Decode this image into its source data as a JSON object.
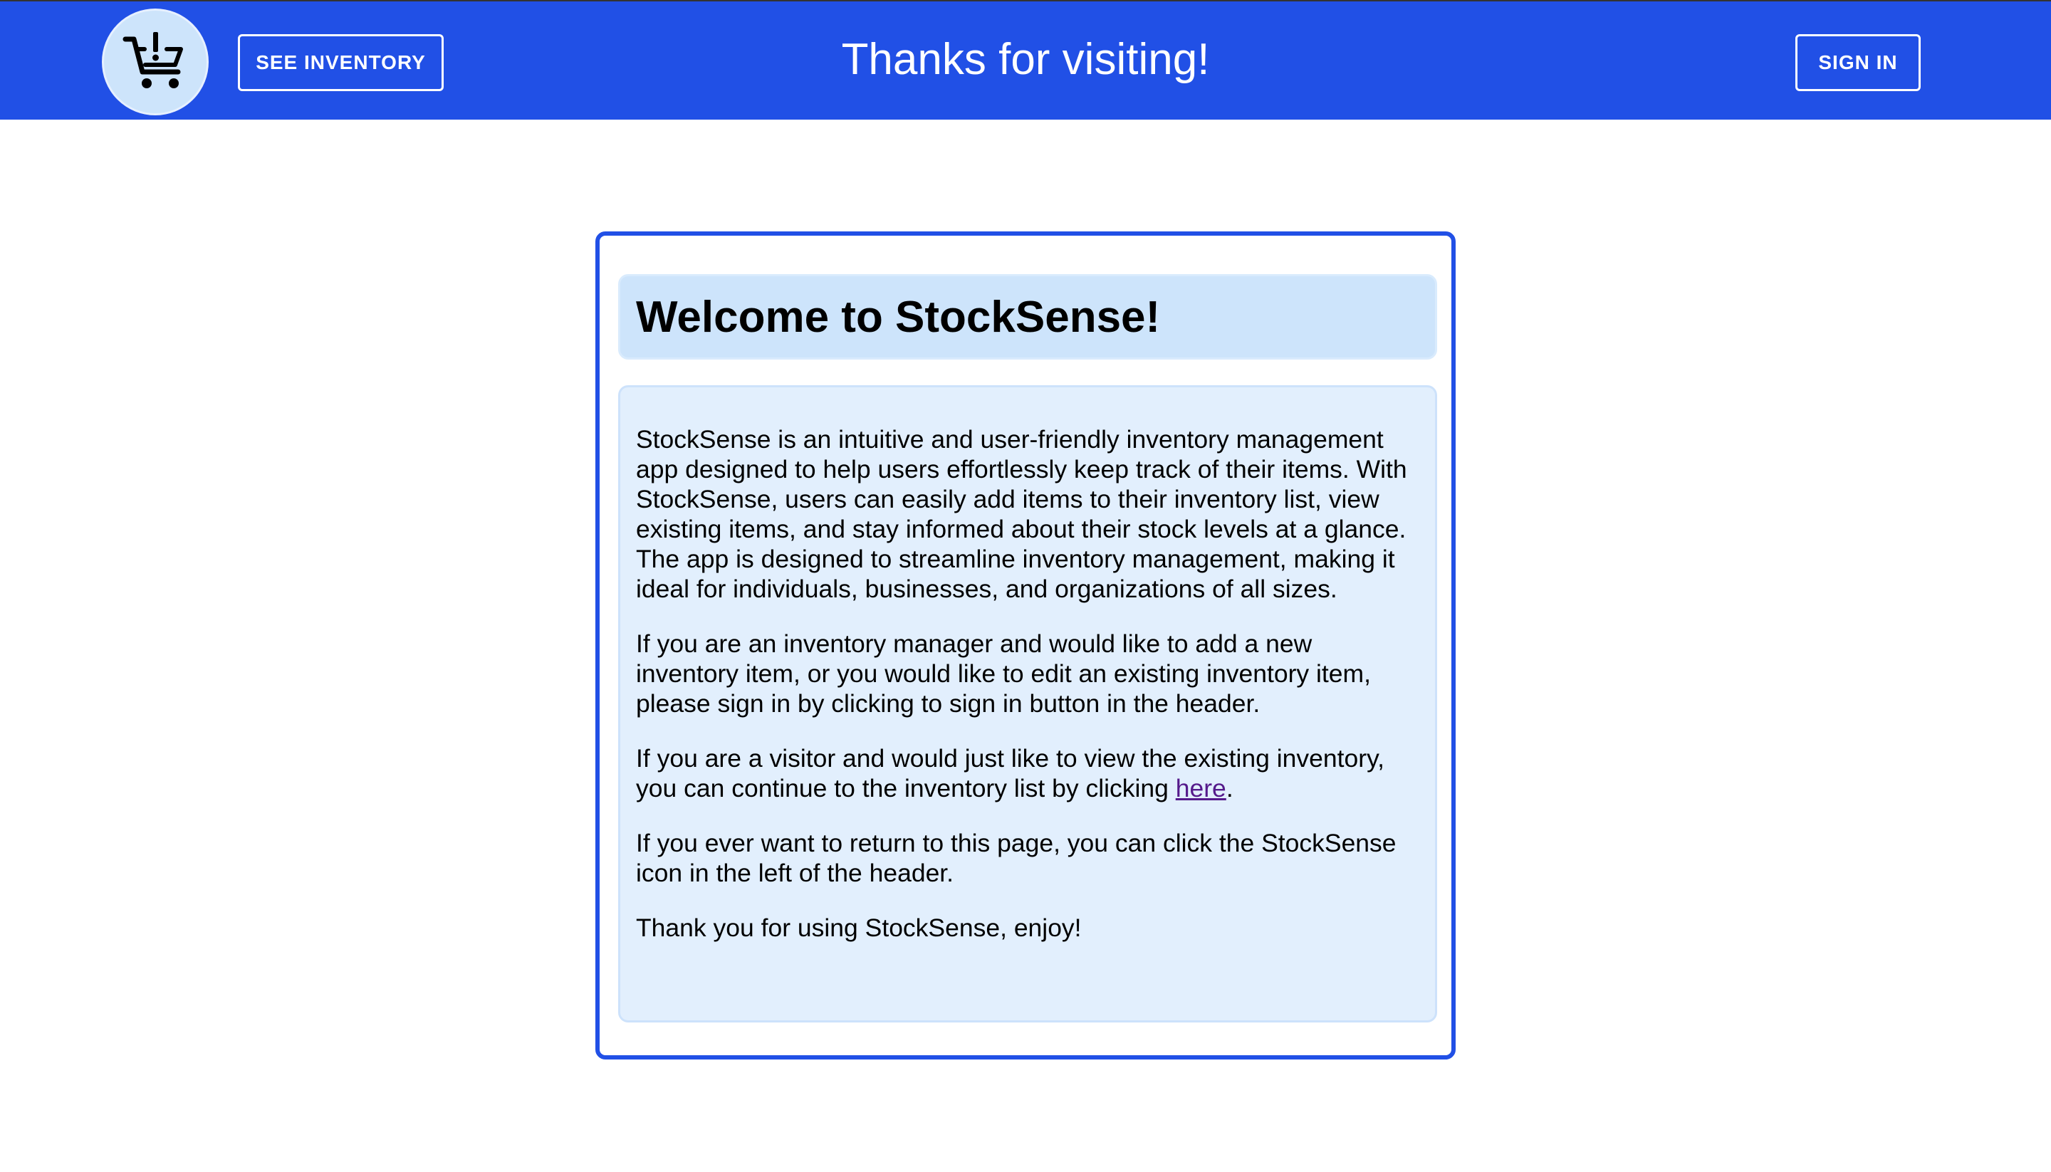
{
  "header": {
    "logo_icon": "shopping-cart-alert-icon",
    "see_inventory_label": "SEE INVENTORY",
    "title": "Thanks for visiting!",
    "sign_in_label": "SIGN IN",
    "background_color": "#2150e6"
  },
  "card": {
    "title": "Welcome to StockSense!",
    "paragraph_1": "StockSense is an intuitive and user-friendly inventory management app designed to help users effortlessly keep track of their items. With StockSense, users can easily add items to their inventory list, view existing items, and stay informed about their stock levels at a glance. The app is designed to streamline inventory management, making it ideal for individuals, businesses, and organizations of all sizes.",
    "paragraph_2": "If you are an inventory manager and would like to add a new inventory item, or you would like to edit an existing inventory item, please sign in by clicking to sign in button in the header.",
    "paragraph_3_before": "If you are a visitor and would just like to view the existing inventory, you can continue to the inventory list by clicking ",
    "paragraph_3_link": "here",
    "paragraph_3_after": ".",
    "paragraph_4": "If you ever want to return to this page, you can click the StockSense icon in the left of the header.",
    "paragraph_5": "Thank you for using StockSense, enjoy!",
    "border_color": "#2150e6",
    "title_box_color": "#cde4fb",
    "body_box_color": "#e2effd",
    "link_color": "#551a8b"
  }
}
